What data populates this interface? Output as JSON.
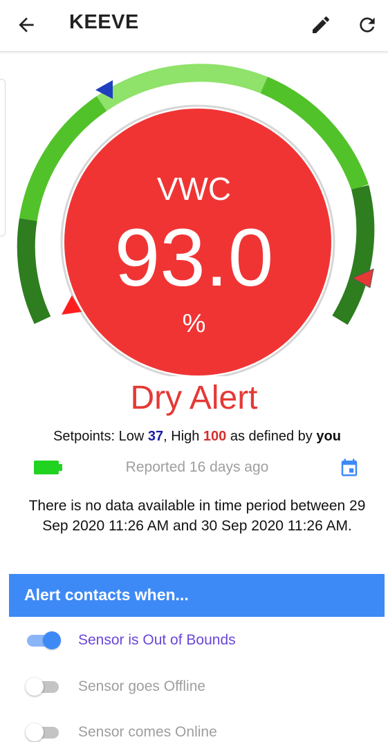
{
  "header": {
    "title": "KEEVE",
    "back_icon": "arrow-left-icon",
    "edit_icon": "pencil-icon",
    "refresh_icon": "refresh-icon"
  },
  "gauge": {
    "label": "VWC",
    "value": "93.0",
    "unit": "%",
    "low_setpoint": 37,
    "high_setpoint": 100,
    "circle_color": "#f03434"
  },
  "status": {
    "text": "Dry Alert",
    "color": "#e53935"
  },
  "setpoints": {
    "prefix": "Setpoints: Low ",
    "low": "37",
    "mid": ", High ",
    "high": "100",
    "suffix": " as defined by ",
    "who": "you"
  },
  "report": {
    "battery_icon": "battery-full-icon",
    "text": "Reported 16 days ago",
    "calendar_icon": "calendar-icon"
  },
  "no_data": {
    "text": "There is no data available in time period between 29 Sep 2020 11:26 AM and 30 Sep 2020 11:26 AM."
  },
  "alerts": {
    "header": "Alert contacts when...",
    "items": [
      {
        "label": "Sensor is Out of Bounds",
        "enabled": true
      },
      {
        "label": "Sensor goes Offline",
        "enabled": false
      },
      {
        "label": "Sensor comes Online",
        "enabled": false
      }
    ]
  },
  "colors": {
    "accent": "#3d8af7",
    "alert_red": "#f03434",
    "gauge_dark_green": "#2e7d1f",
    "gauge_green": "#52c22a",
    "gauge_light_green": "#8fe26a"
  }
}
